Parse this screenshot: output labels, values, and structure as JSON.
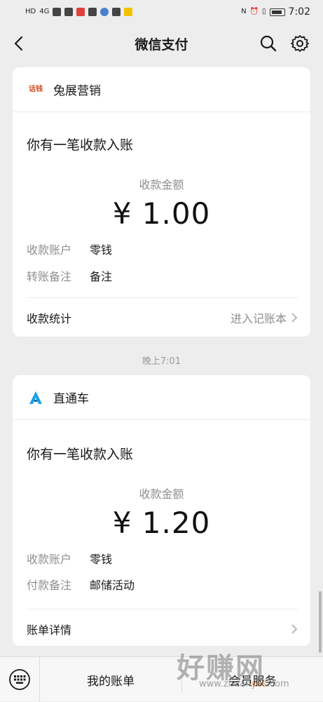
{
  "status_bar": {
    "left_icons": [
      "HD",
      "4G",
      "signal",
      "wifi-off",
      "app",
      "app",
      "app",
      "app",
      "app"
    ],
    "time": "7:02"
  },
  "nav": {
    "title": "微信支付"
  },
  "cards": [
    {
      "merchant": "兔展营销",
      "logo_text": "话钱",
      "message": "你有一笔收款入账",
      "amount_label": "收款金额",
      "amount": "¥ 1.00",
      "rows": [
        {
          "label": "收款账户",
          "value": "零钱"
        },
        {
          "label": "转账备注",
          "value": "备注"
        }
      ],
      "footer_left": "收款统计",
      "footer_right": "进入记账本"
    },
    {
      "merchant": "直通车",
      "message": "你有一笔收款入账",
      "amount_label": "收款金额",
      "amount": "¥ 1.20",
      "rows": [
        {
          "label": "收款账户",
          "value": "零钱"
        },
        {
          "label": "付款备注",
          "value": "邮储活动"
        }
      ],
      "footer_left": "账单详情",
      "footer_right": ""
    }
  ],
  "timestamp": "晚上7:01",
  "bottom_bar": {
    "items": [
      "我的账单",
      "会员服务"
    ]
  },
  "watermark": {
    "main": "好赚网",
    "sub_prefix": "www.zhuan",
    "sub_accent": "yes",
    "sub_suffix": ".com"
  },
  "colors": {
    "background": "#ededed",
    "card": "#ffffff",
    "muted": "#8f8f8f",
    "logo_accent": "#d84a1b",
    "logo_blue": "#1aa0e6"
  }
}
